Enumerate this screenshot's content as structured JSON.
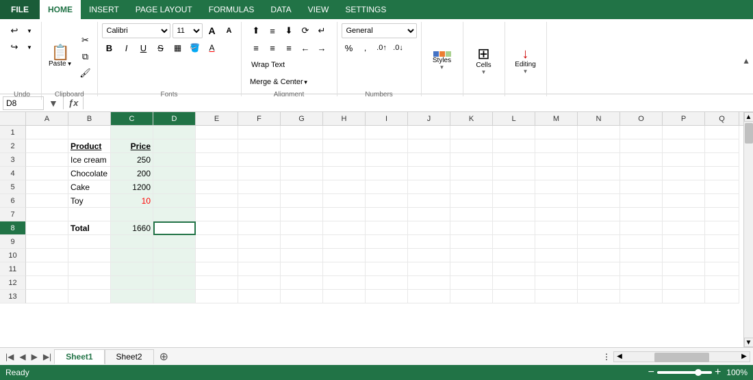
{
  "tabs": {
    "file": "FILE",
    "home": "HOME",
    "insert": "INSERT",
    "pageLayout": "PAGE LAYOUT",
    "formulas": "FORMULAS",
    "data": "DATA",
    "view": "VIEW",
    "settings": "SETTINGS"
  },
  "ribbon": {
    "undo": {
      "label": "Undo"
    },
    "clipboard": {
      "paste": "Paste",
      "cut": "Cut",
      "copy": "Copy",
      "formatPainter": "Format Painter",
      "label": "Clipboard"
    },
    "fonts": {
      "fontName": "Calibri",
      "fontSize": "11",
      "bold": "B",
      "italic": "I",
      "underline": "U",
      "strikethrough": "S",
      "increaseFontSize": "A",
      "decreaseFontSize": "A",
      "label": "Fonts"
    },
    "alignment": {
      "label": "Alignment",
      "wrapText": "Wrap Text",
      "mergeCenter": "Merge & Center"
    },
    "number": {
      "format": "General",
      "label": "Numbers",
      "percent": "%",
      "comma": ",",
      "increaseDecimal": ".0",
      "decreaseDecimal": ".00"
    },
    "styles": {
      "label": "Styles",
      "button": "Styles"
    },
    "cells": {
      "label": "Cells",
      "button": "Cells"
    },
    "editing": {
      "label": "Editing",
      "button": "Editing"
    },
    "collapseBtn": "▲"
  },
  "formulaBar": {
    "cellRef": "D8",
    "expandBtn": "▼",
    "funcBtn": "fx",
    "value": ""
  },
  "columns": [
    "A",
    "B",
    "C",
    "D",
    "E",
    "F",
    "G",
    "H",
    "I",
    "J",
    "K",
    "L",
    "M",
    "N",
    "O",
    "P",
    "Q"
  ],
  "rows": [
    1,
    2,
    3,
    4,
    5,
    6,
    7,
    8,
    9,
    10,
    11,
    12,
    13
  ],
  "cells": {
    "B2": {
      "value": "Product",
      "bold": true,
      "underline": true
    },
    "C2": {
      "value": "Price",
      "bold": true,
      "underline": true,
      "alignRight": true
    },
    "B3": {
      "value": "Ice cream"
    },
    "C3": {
      "value": "250",
      "alignRight": true
    },
    "B4": {
      "value": "Chocolate"
    },
    "C4": {
      "value": "200",
      "alignRight": true
    },
    "B5": {
      "value": "Cake"
    },
    "C5": {
      "value": "1200",
      "alignRight": true
    },
    "B6": {
      "value": "Toy"
    },
    "C6": {
      "value": "10",
      "alignRight": true,
      "red": true
    },
    "B8": {
      "value": "Total",
      "bold": true
    },
    "C8": {
      "value": "1660",
      "alignRight": true
    },
    "D8": {
      "value": "",
      "active": true
    }
  },
  "sheetTabs": [
    "Sheet1",
    "Sheet2"
  ],
  "activeSheet": "Sheet1",
  "statusBar": {
    "status": "Ready",
    "zoomPercent": "100%",
    "zoomMinus": "−",
    "zoomPlus": "+"
  }
}
